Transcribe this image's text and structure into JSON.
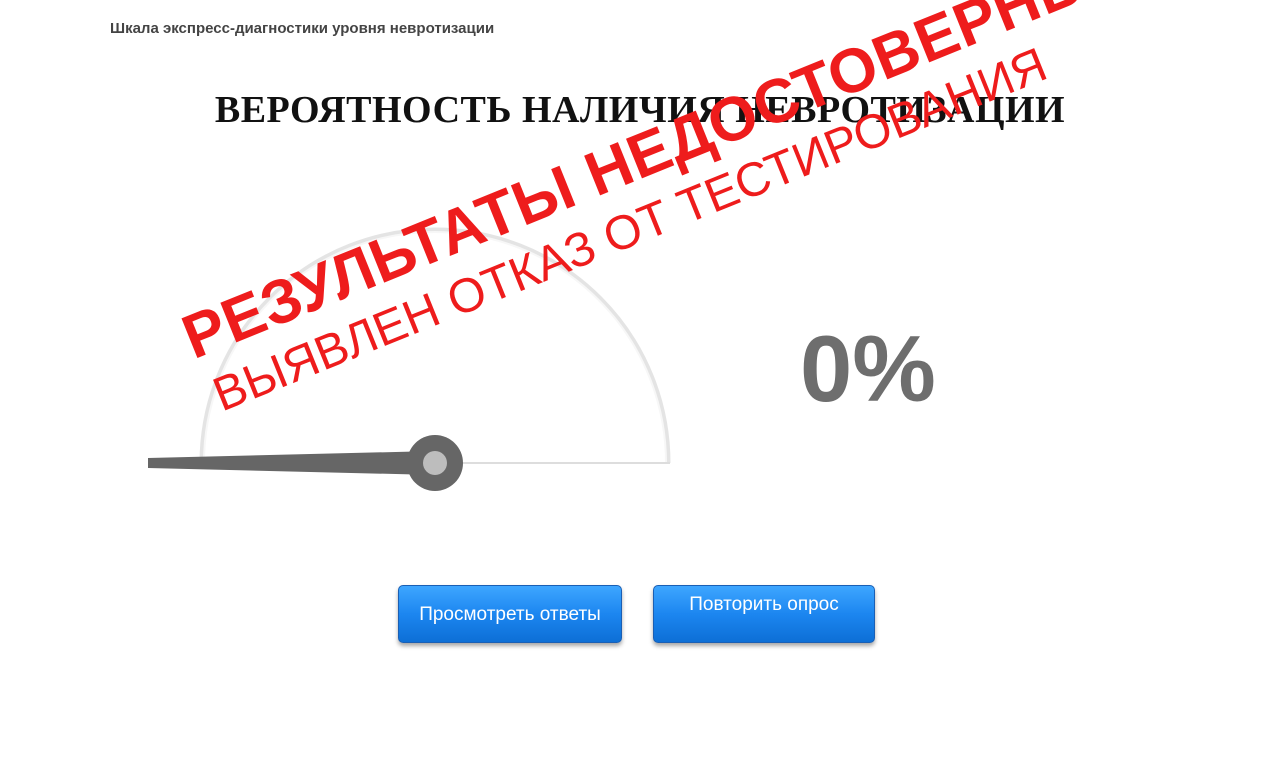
{
  "header": {
    "app_title": "Шкала экспресс-диагностики уровня невротизации"
  },
  "result": {
    "heading": "ВЕРОЯТНОСТЬ НАЛИЧИЯ НЕВРОТИЗАЦИИ",
    "percent_text": "0%",
    "gauge_value_percent": 0
  },
  "stamp": {
    "line1": "РЕЗУЛЬТАТЫ НЕДОСТОВЕРНЫ",
    "line2": "ВЫЯВЛЕН ОТКАЗ ОТ ТЕСТИРОВАНИЯ",
    "color": "#ee1c1c"
  },
  "buttons": {
    "view_answers_label": "Просмотреть ответы",
    "repeat_label": "Повторить опрос"
  },
  "colors": {
    "button_blue": "#1c86f0",
    "gauge_needle": "#666666",
    "percent_text": "#6e6e6e"
  }
}
